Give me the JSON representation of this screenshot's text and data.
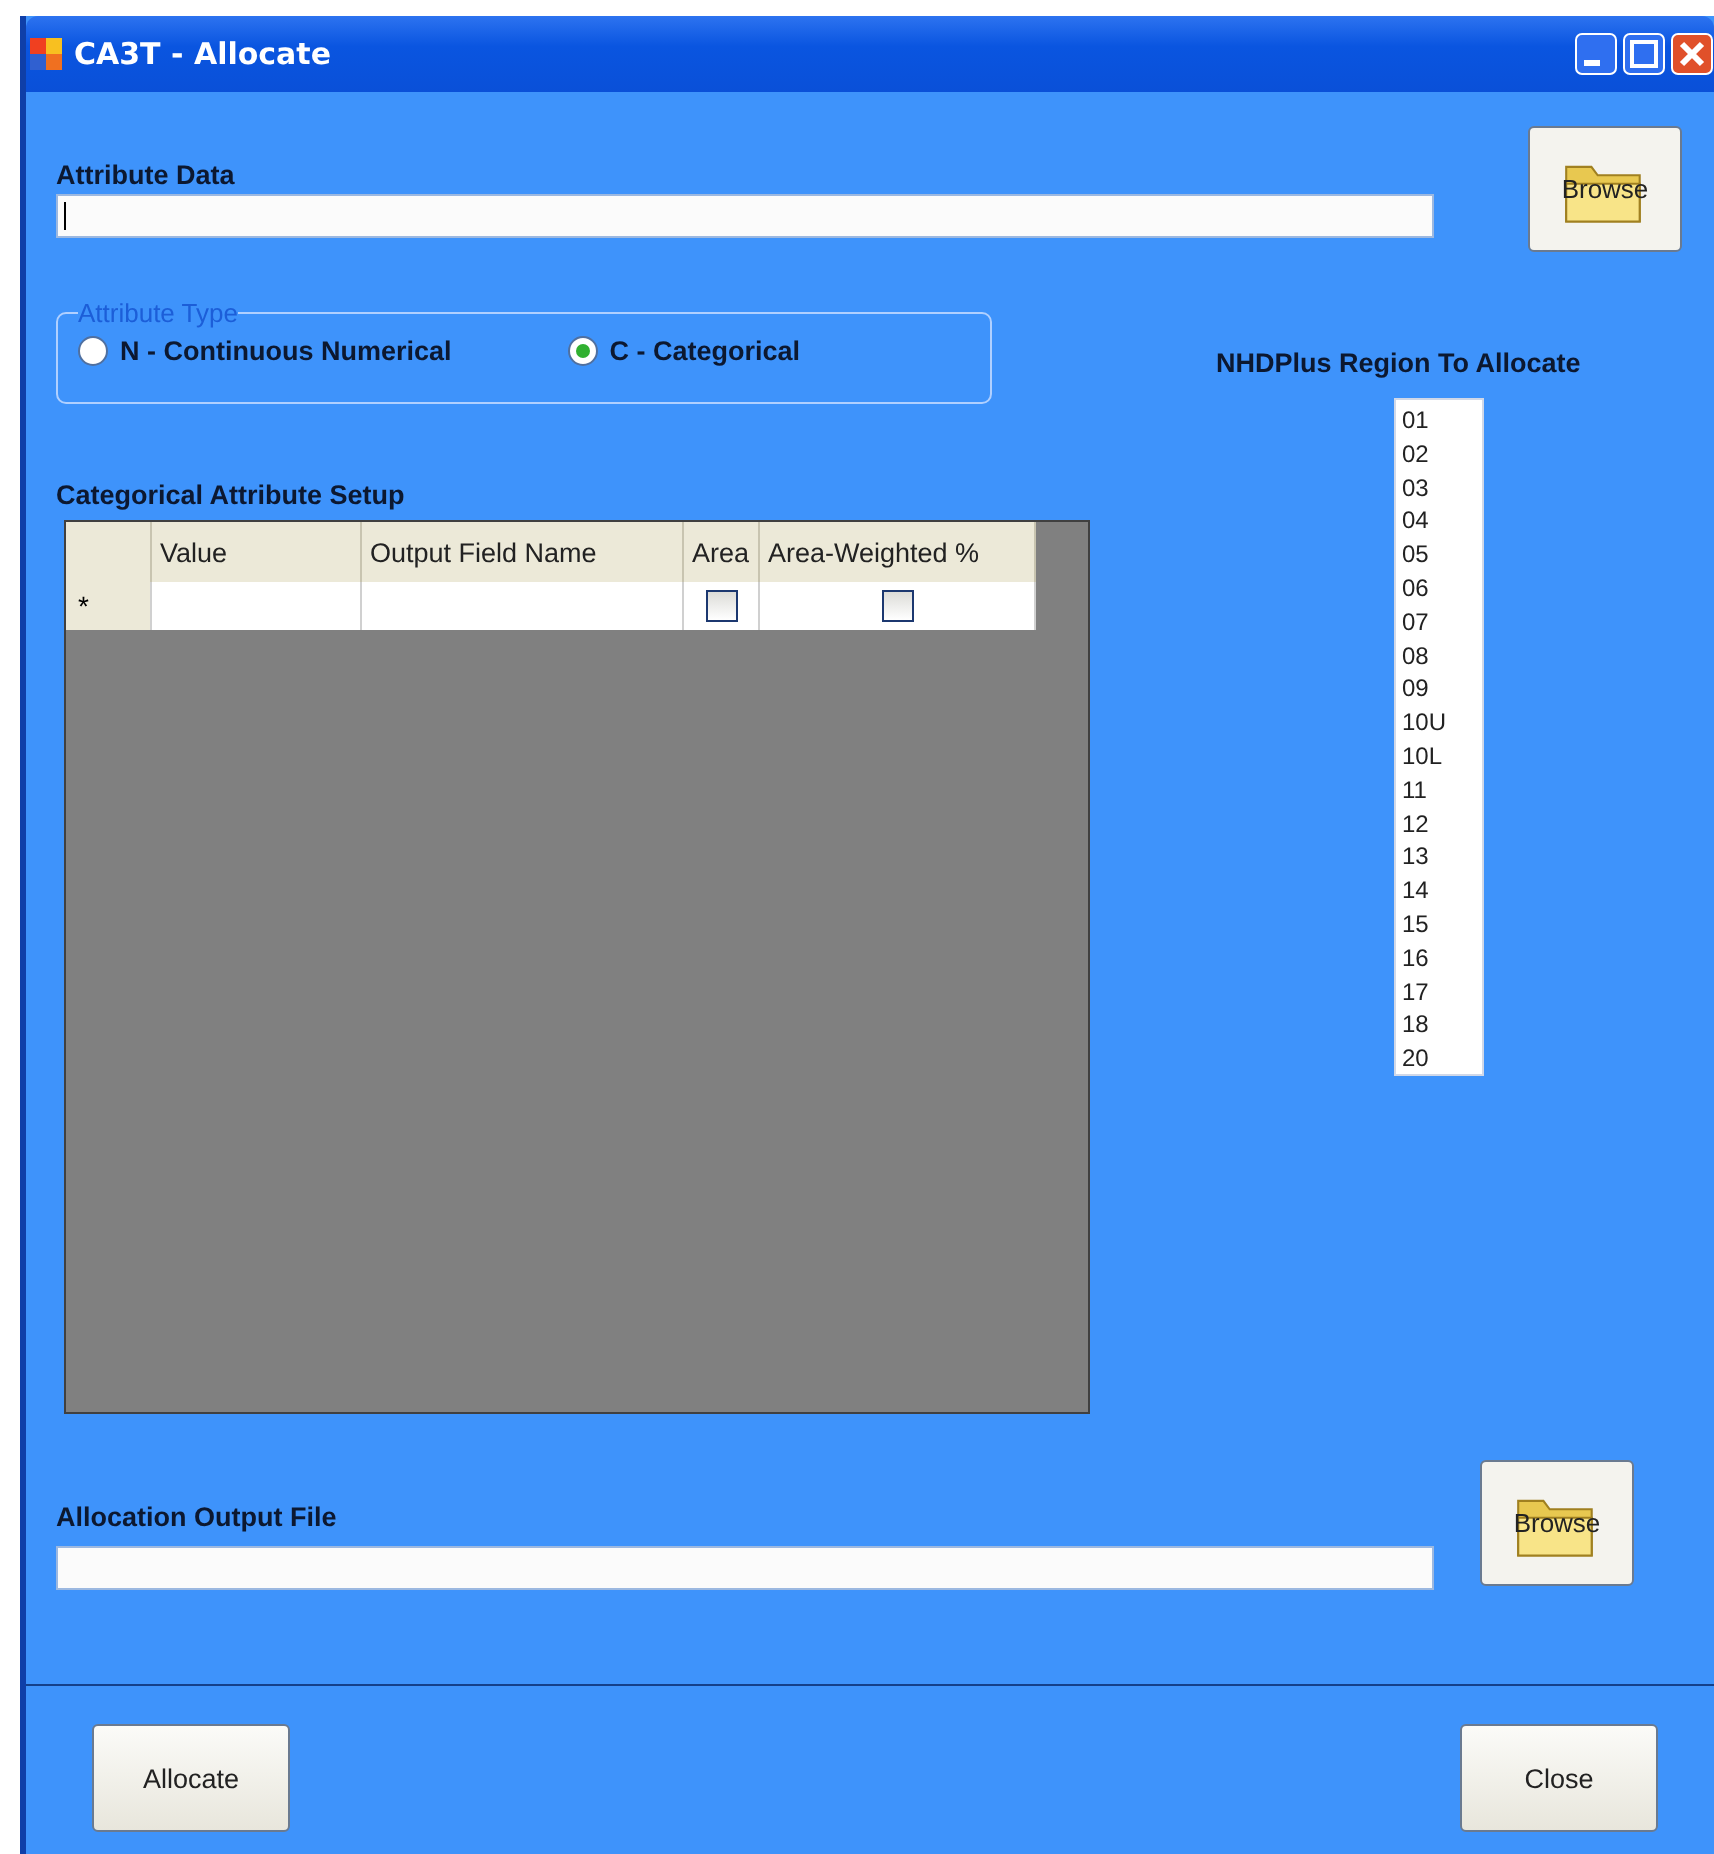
{
  "window": {
    "title": "CA3T - Allocate"
  },
  "attribute_data": {
    "label": "Attribute Data",
    "browse": "Browse"
  },
  "attribute_type": {
    "legend": "Attribute Type",
    "options": [
      {
        "label": "N - Continuous Numerical",
        "selected": false
      },
      {
        "label": "C - Categorical",
        "selected": true
      }
    ]
  },
  "region": {
    "label": "NHDPlus Region To Allocate",
    "items": [
      "01",
      "02",
      "03",
      "04",
      "05",
      "06",
      "07",
      "08",
      "09",
      "10U",
      "10L",
      "11",
      "12",
      "13",
      "14",
      "15",
      "16",
      "17",
      "18",
      "20"
    ]
  },
  "grid": {
    "title": "Categorical Attribute Setup",
    "columns": [
      "Value",
      "Output Field Name",
      "Area",
      "Area-Weighted %"
    ],
    "new_row": {
      "marker": "*",
      "area_checked": false,
      "weighted_checked": false
    }
  },
  "output_file": {
    "label": "Allocation Output File",
    "browse": "Browse"
  },
  "buttons": [
    "Allocate",
    "Close"
  ]
}
